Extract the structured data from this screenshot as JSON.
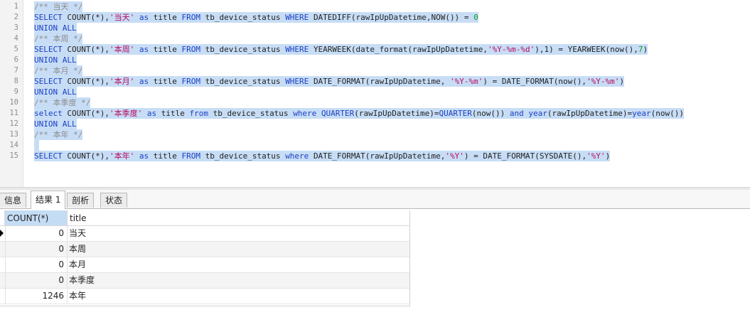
{
  "editor": {
    "lines": [
      {
        "n": "1",
        "sel": true,
        "parts": [
          [
            "cm",
            "/** 当天 */"
          ]
        ]
      },
      {
        "n": "2",
        "sel": true,
        "parts": [
          [
            "kw",
            "SELECT "
          ],
          [
            "tx",
            "COUNT(*),"
          ],
          [
            "str",
            "'当天'"
          ],
          [
            "kw",
            " as "
          ],
          [
            "tx",
            "title "
          ],
          [
            "kw",
            "FROM "
          ],
          [
            "tx",
            "tb_device_status "
          ],
          [
            "kw",
            "WHERE "
          ],
          [
            "tx",
            "DATEDIFF(rawIpUpDatetime,NOW()) = "
          ],
          [
            "num",
            "0"
          ]
        ]
      },
      {
        "n": "3",
        "sel": true,
        "parts": [
          [
            "kw",
            "UNION ALL"
          ]
        ]
      },
      {
        "n": "4",
        "sel": true,
        "parts": [
          [
            "cm",
            "/** 本周 */"
          ]
        ]
      },
      {
        "n": "5",
        "sel": true,
        "parts": [
          [
            "kw",
            "SELECT "
          ],
          [
            "tx",
            "COUNT(*),"
          ],
          [
            "str",
            "'本周'"
          ],
          [
            "kw",
            " as "
          ],
          [
            "tx",
            "title "
          ],
          [
            "kw",
            "FROM "
          ],
          [
            "tx",
            "tb_device_status "
          ],
          [
            "kw",
            "WHERE "
          ],
          [
            "tx",
            "YEARWEEK(date_format(rawIpUpDatetime,"
          ],
          [
            "str",
            "'%Y-%m-%d'"
          ],
          [
            "tx",
            "),1) = YEARWEEK(now(),"
          ],
          [
            "num",
            "7"
          ],
          [
            "tx",
            ")"
          ]
        ]
      },
      {
        "n": "6",
        "sel": true,
        "parts": [
          [
            "kw",
            "UNION ALL"
          ]
        ]
      },
      {
        "n": "7",
        "sel": true,
        "parts": [
          [
            "cm",
            "/** 本月 */"
          ]
        ]
      },
      {
        "n": "8",
        "sel": true,
        "parts": [
          [
            "kw",
            "SELECT "
          ],
          [
            "tx",
            "COUNT(*),"
          ],
          [
            "str",
            "'本月'"
          ],
          [
            "kw",
            " as "
          ],
          [
            "tx",
            "title "
          ],
          [
            "kw",
            "FROM "
          ],
          [
            "tx",
            "tb_device_status "
          ],
          [
            "kw",
            "WHERE "
          ],
          [
            "tx",
            "DATE_FORMAT(rawIpUpDatetime, "
          ],
          [
            "str",
            "'%Y-%m'"
          ],
          [
            "tx",
            ") = DATE_FORMAT(now(),"
          ],
          [
            "str",
            "'%Y-%m'"
          ],
          [
            "tx",
            ")"
          ]
        ]
      },
      {
        "n": "9",
        "sel": true,
        "parts": [
          [
            "kw",
            "UNION ALL"
          ]
        ]
      },
      {
        "n": "10",
        "sel": true,
        "parts": [
          [
            "cm",
            "/** 本季度 */"
          ]
        ]
      },
      {
        "n": "11",
        "sel": true,
        "parts": [
          [
            "kw",
            "select "
          ],
          [
            "tx",
            "COUNT(*),"
          ],
          [
            "str",
            "'本季度'"
          ],
          [
            "kw",
            " as "
          ],
          [
            "tx",
            "title "
          ],
          [
            "kw",
            "from "
          ],
          [
            "tx",
            "tb_device_status "
          ],
          [
            "kw",
            "where "
          ],
          [
            "fn",
            "QUARTER"
          ],
          [
            "tx",
            "(rawIpUpDatetime)="
          ],
          [
            "fn",
            "QUARTER"
          ],
          [
            "tx",
            "(now()) "
          ],
          [
            "kw",
            "and "
          ],
          [
            "fn",
            "year"
          ],
          [
            "tx",
            "(rawIpUpDatetime)="
          ],
          [
            "fn",
            "year"
          ],
          [
            "tx",
            "(now())"
          ]
        ]
      },
      {
        "n": "12",
        "sel": true,
        "parts": [
          [
            "kw",
            "UNION ALL"
          ]
        ]
      },
      {
        "n": "13",
        "sel": true,
        "parts": [
          [
            "cm",
            "/** 本年 */"
          ]
        ]
      },
      {
        "n": "14",
        "sel": true,
        "parts": [
          [
            "tx",
            " "
          ]
        ]
      },
      {
        "n": "15",
        "sel": true,
        "parts": [
          [
            "kw",
            "SELECT "
          ],
          [
            "tx",
            "COUNT(*),"
          ],
          [
            "str",
            "'本年'"
          ],
          [
            "kw",
            " as "
          ],
          [
            "tx",
            "title "
          ],
          [
            "kw",
            "FROM "
          ],
          [
            "tx",
            "tb_device_status "
          ],
          [
            "kw",
            "where "
          ],
          [
            "tx",
            "DATE_FORMAT(rawIpUpDatetime,"
          ],
          [
            "str",
            "'%Y'"
          ],
          [
            "tx",
            ") = DATE_FORMAT(SYSDATE(),"
          ],
          [
            "str",
            "'%Y'"
          ],
          [
            "tx",
            ")"
          ]
        ]
      }
    ]
  },
  "tabs": {
    "info": "信息",
    "result": "结果 1",
    "profile": "剖析",
    "status": "状态"
  },
  "grid": {
    "headers": [
      "COUNT(*)",
      "title"
    ],
    "rows": [
      {
        "count": "0",
        "title": "当天"
      },
      {
        "count": "0",
        "title": "本周"
      },
      {
        "count": "0",
        "title": "本月"
      },
      {
        "count": "0",
        "title": "本季度"
      },
      {
        "count": "1246",
        "title": "本年"
      }
    ]
  },
  "colors": {
    "selection": "#c7ddf5",
    "keyword": "#1b3fc5",
    "string": "#ba0a5e",
    "comment": "#8c8c8c",
    "number": "#0b9c2d"
  }
}
